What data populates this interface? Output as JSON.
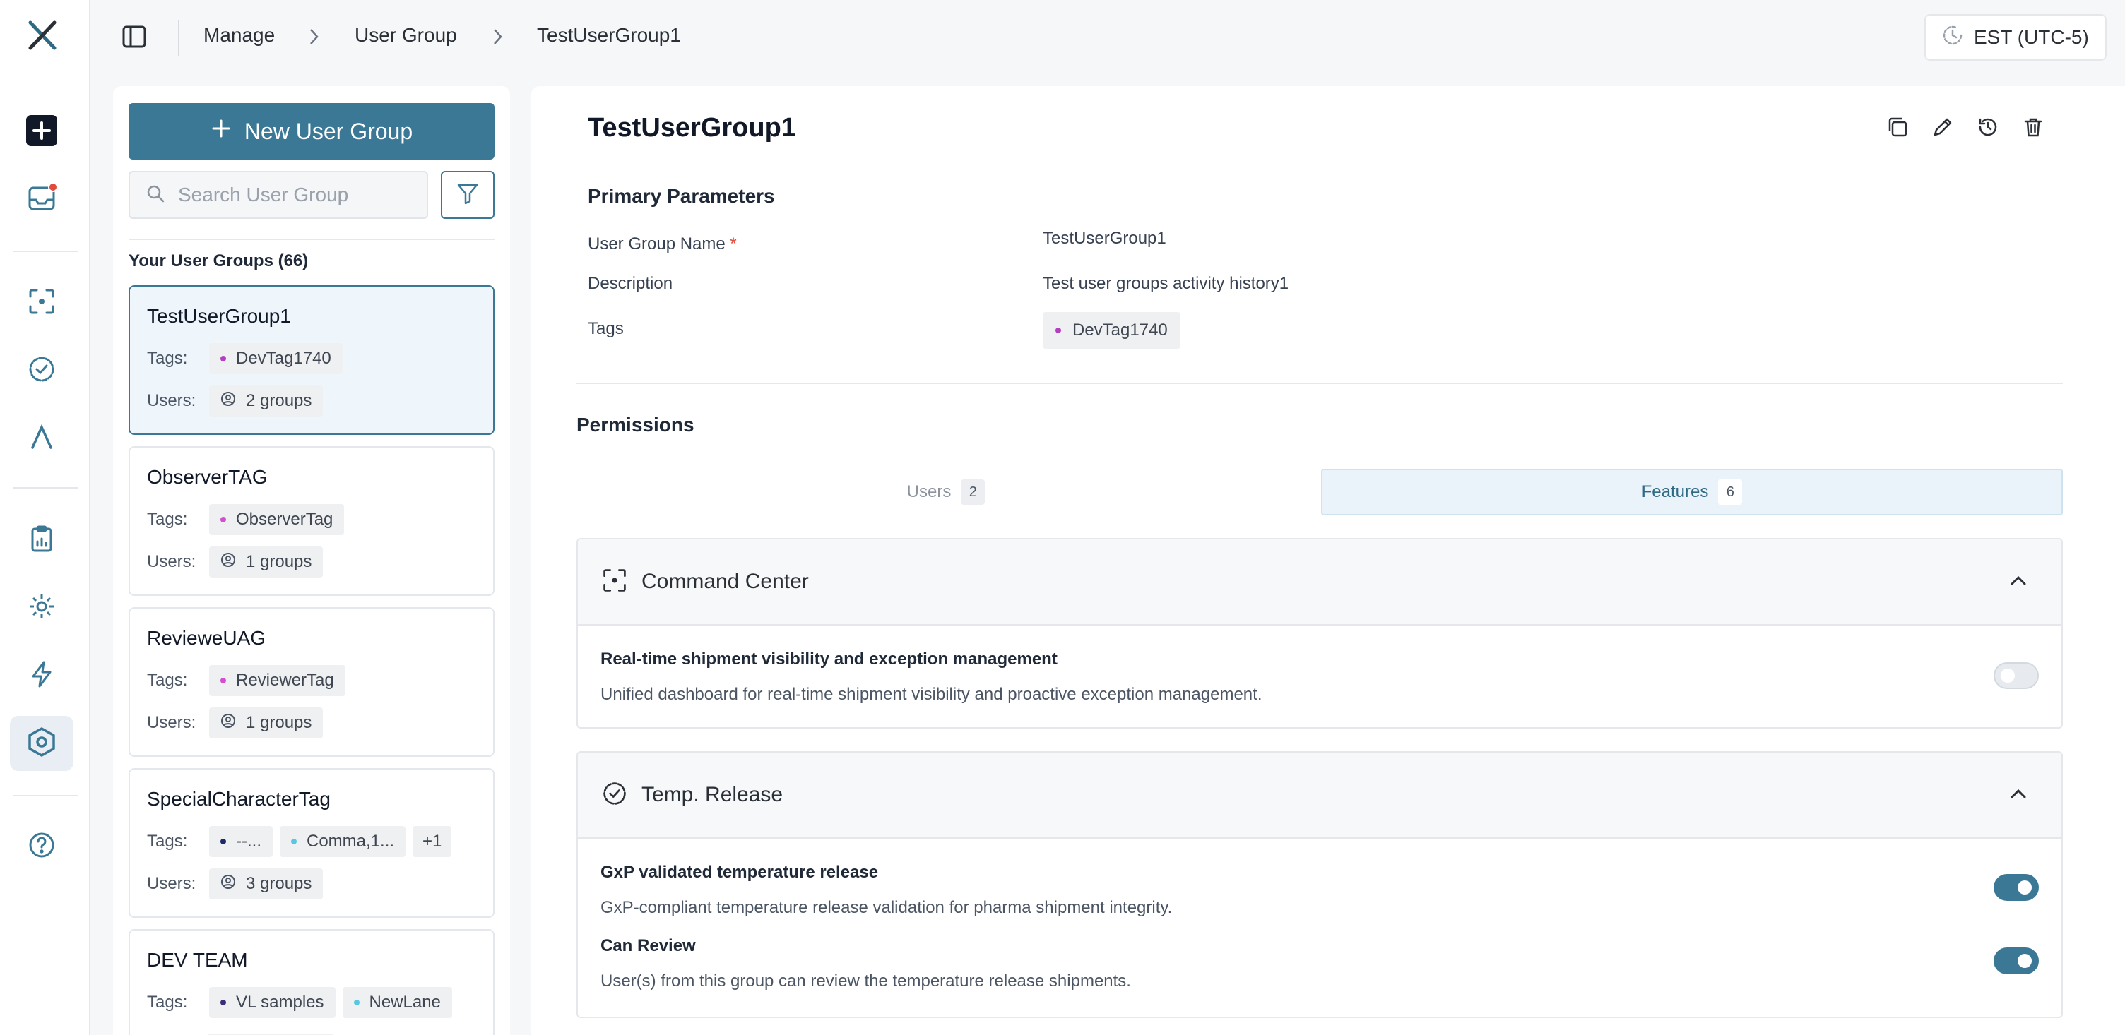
{
  "app": {
    "logo": "X",
    "colors": {
      "accent": "#3a7896",
      "tag_purple": "#b23fc1",
      "tag_navy": "#1d2a6b",
      "tag_cyan": "#58c7e3",
      "notification": "#e04b3c"
    }
  },
  "rail": {
    "items": [
      {
        "icon": "plus-square-icon"
      },
      {
        "icon": "inbox-icon",
        "has_notification": true
      },
      {
        "icon": "scan-icon"
      },
      {
        "icon": "check-circle-icon"
      },
      {
        "icon": "lambda-icon"
      },
      {
        "icon": "clipboard-chart-icon"
      },
      {
        "icon": "gear-icon"
      },
      {
        "icon": "lightning-icon"
      },
      {
        "icon": "hexagon-settings-icon",
        "active": true
      },
      {
        "icon": "help-icon"
      }
    ]
  },
  "header": {
    "breadcrumbs": [
      "Manage",
      "User Group",
      "TestUserGroup1"
    ],
    "timezone": "EST (UTC-5)"
  },
  "list": {
    "new_button_label": "New User Group",
    "search_placeholder": "Search User Group",
    "heading": "Your User Groups (66)",
    "tags_label": "Tags:",
    "users_label": "Users:",
    "cards": [
      {
        "name": "TestUserGroup1",
        "tags": [
          {
            "label": "DevTag1740",
            "color": "#b23fc1"
          }
        ],
        "users": "2 groups",
        "selected": true
      },
      {
        "name": "ObserverTAG",
        "tags": [
          {
            "label": "ObserverTag",
            "color": "#d44fcf"
          }
        ],
        "users": "1 groups"
      },
      {
        "name": "RevieweUAG",
        "tags": [
          {
            "label": "ReviewerTag",
            "color": "#d44fcf"
          }
        ],
        "users": "1 groups"
      },
      {
        "name": "SpecialCharacterTag",
        "tags": [
          {
            "label": "--...",
            "color": "#1d2a6b"
          },
          {
            "label": "Comma,1...",
            "color": "#58c7e3"
          }
        ],
        "extra_tags": "+1",
        "users": "3 groups"
      },
      {
        "name": "DEV TEAM",
        "tags": [
          {
            "label": "VL samples",
            "color": "#3d2f7a"
          },
          {
            "label": "NewLane",
            "color": "#58c7e3"
          }
        ]
      }
    ]
  },
  "detail": {
    "title": "TestUserGroup1",
    "actions": [
      "copy-icon",
      "edit-icon",
      "history-icon",
      "trash-icon"
    ],
    "primary_heading": "Primary Parameters",
    "params": {
      "name_label": "User Group Name",
      "name_required": "*",
      "name_value": "TestUserGroup1",
      "description_label": "Description",
      "description_value": "Test user groups activity history1",
      "tags_label": "Tags",
      "tag_value": "DevTag1740"
    },
    "permissions_heading": "Permissions",
    "tabs": [
      {
        "label": "Users",
        "count": "2",
        "active": false
      },
      {
        "label": "Features",
        "count": "6",
        "active": true
      }
    ],
    "sections": [
      {
        "title": "Command Center",
        "icon": "scan-icon",
        "expanded": true,
        "features": [
          {
            "title": "Real-time shipment visibility and exception management",
            "description": "Unified dashboard for real-time shipment visibility and proactive exception management.",
            "enabled": false
          }
        ]
      },
      {
        "title": "Temp. Release",
        "icon": "check-circle-icon",
        "expanded": true,
        "features": [
          {
            "title": "GxP validated temperature release",
            "description": "GxP-compliant temperature release validation for pharma shipment integrity.",
            "enabled": true
          },
          {
            "title": "Can Review",
            "description": "User(s) from this group can review the temperature release shipments.",
            "enabled": true
          }
        ]
      }
    ]
  }
}
